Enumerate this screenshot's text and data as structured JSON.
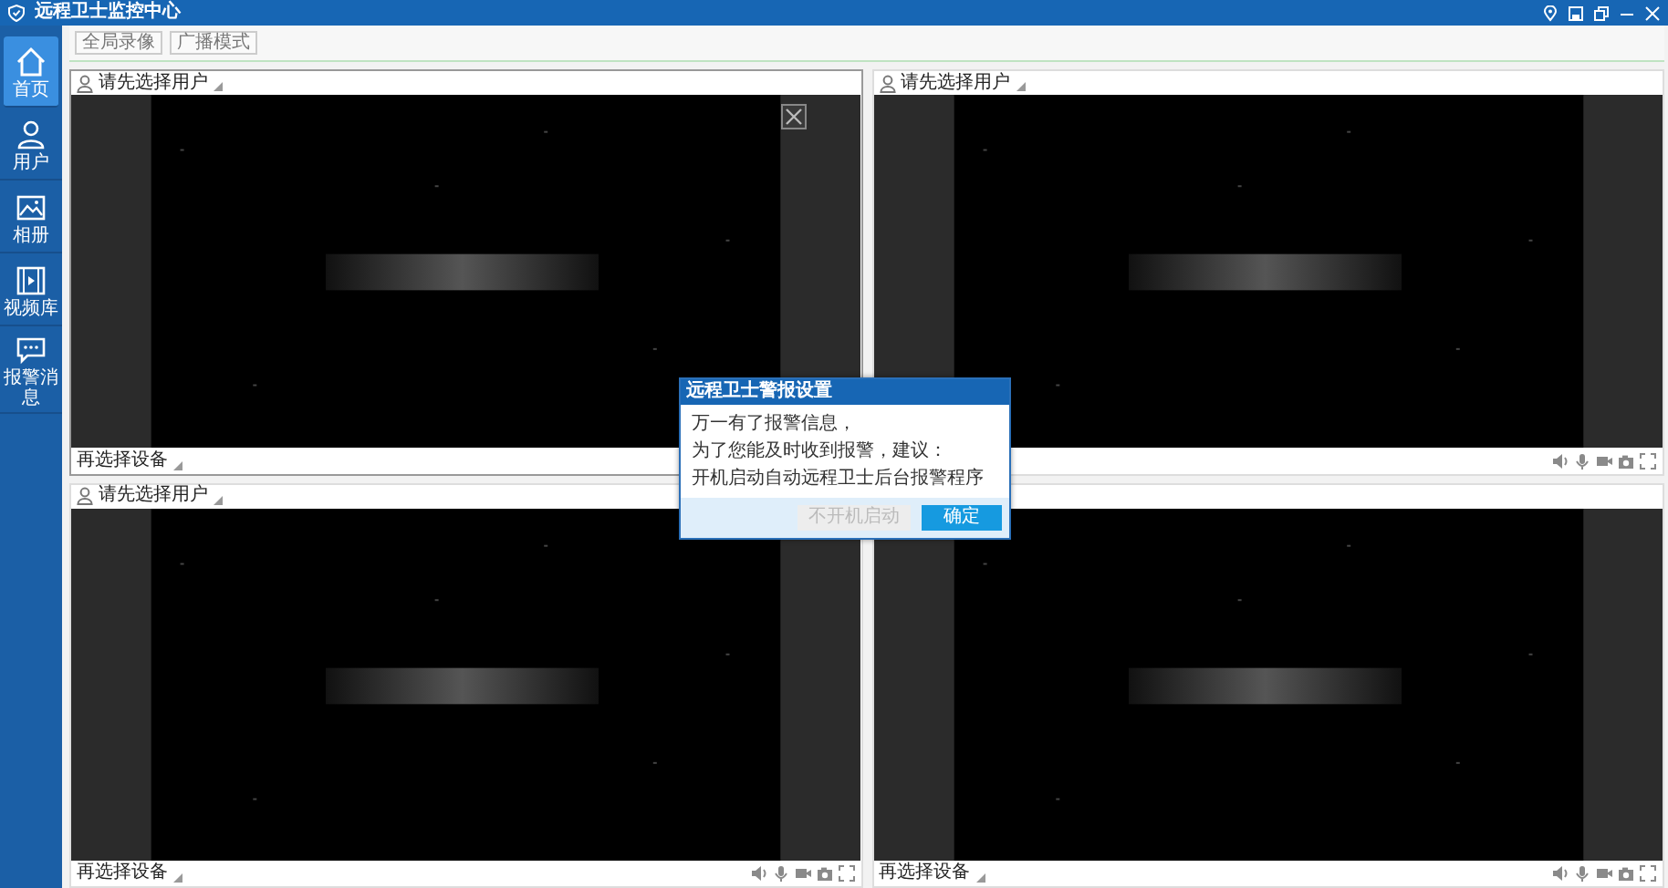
{
  "window": {
    "title": "远程卫士监控中心"
  },
  "sidebar": {
    "items": [
      {
        "label": "首页",
        "selected": true
      },
      {
        "label": "用户",
        "selected": false
      },
      {
        "label": "相册",
        "selected": false
      },
      {
        "label": "视频库",
        "selected": false
      },
      {
        "label": "报警消息",
        "selected": false
      }
    ]
  },
  "toolbar": {
    "buttons": [
      "全局录像",
      "广播模式"
    ]
  },
  "panels": [
    {
      "header_label": "请先选择用户",
      "footer_label": "再选择设备",
      "selected": true,
      "closable": true,
      "controls": false
    },
    {
      "header_label": "请先选择用户",
      "selected": false,
      "closable": false,
      "controls": true
    },
    {
      "header_label": "请先选择用户",
      "footer_label": "再选择设备",
      "selected": false,
      "closable": false,
      "controls": true
    },
    {
      "footer_label": "再选择设备",
      "selected": false,
      "closable": false,
      "controls": true
    }
  ],
  "dialog": {
    "title": "远程卫士警报设置",
    "lines": [
      "万一有了报警信息，",
      "为了您能及时收到报警，建议：",
      "开机启动自动远程卫士后台报警程序"
    ],
    "buttons": [
      {
        "label": "不开机启动",
        "kind": "secondary",
        "disabled": true
      },
      {
        "label": "确定",
        "kind": "primary",
        "disabled": false
      }
    ]
  }
}
